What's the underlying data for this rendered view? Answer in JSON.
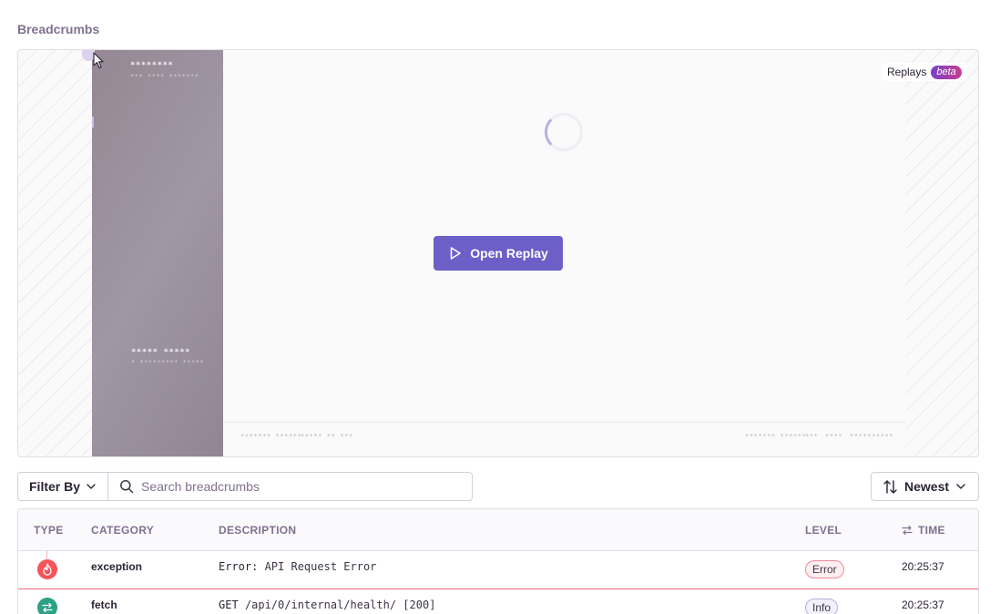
{
  "section": {
    "title": "Breadcrumbs"
  },
  "replay": {
    "badge_label": "Replays",
    "beta_label": "beta",
    "open_button_label": "Open Replay",
    "mock_text": {
      "sidebar_title": "********",
      "sidebar_subtitle": "*** **** *******",
      "sidebar_item_title": "***** *****",
      "sidebar_item_subtitle": "* ********* *****",
      "footer_left_1": "******* ******",
      "footer_left_2": "***** ** ***",
      "footer_right_1": "******* ******",
      "footer_right_2": "***",
      "footer_right_3": "****",
      "footer_right_4": "**********"
    }
  },
  "controls": {
    "filter_label": "Filter By",
    "search_placeholder": "Search breadcrumbs",
    "sort_label": "Newest"
  },
  "table": {
    "headers": {
      "type": "TYPE",
      "category": "CATEGORY",
      "description": "DESCRIPTION",
      "level": "LEVEL",
      "time": "TIME"
    },
    "rows": [
      {
        "type_icon": "fire-icon",
        "color": "#f55459",
        "category": "exception",
        "desc_prefix": "Error:",
        "desc_rest": " API Request Error",
        "level": "Error",
        "time": "20:25:37"
      },
      {
        "type_icon": "arrows-swap-icon",
        "color": "#2ba185",
        "category": "fetch",
        "desc_prefix": "GET",
        "desc_rest": " /api/0/internal/health/ [200]",
        "level": "Info",
        "time": "20:25:37"
      }
    ]
  },
  "colors": {
    "accent": "#6c5fc7",
    "error": "#f55459",
    "success": "#2ba185",
    "muted_text": "#80708f"
  }
}
